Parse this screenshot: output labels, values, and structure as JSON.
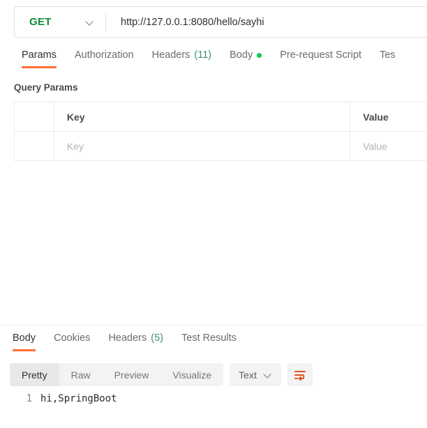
{
  "request": {
    "method": "GET",
    "url": "http://127.0.0.1:8080/hello/sayhi",
    "method_chevron_icon": "chevron-down-icon",
    "tabs": [
      {
        "label": "Params",
        "count": "",
        "active": true,
        "dot": false
      },
      {
        "label": "Authorization",
        "count": "",
        "active": false,
        "dot": false
      },
      {
        "label": "Headers",
        "count": "(11)",
        "active": false,
        "dot": false
      },
      {
        "label": "Body",
        "count": "",
        "active": false,
        "dot": true
      },
      {
        "label": "Pre-request Script",
        "count": "",
        "active": false,
        "dot": false
      },
      {
        "label": "Tes",
        "count": "",
        "active": false,
        "dot": false
      }
    ],
    "params": {
      "section_title": "Query Params",
      "columns": [
        "Key",
        "Value"
      ],
      "rows": [
        {
          "key_placeholder": "Key",
          "value_placeholder": "Value"
        }
      ]
    }
  },
  "response": {
    "tabs": [
      {
        "label": "Body",
        "count": "",
        "active": true
      },
      {
        "label": "Cookies",
        "count": "",
        "active": false
      },
      {
        "label": "Headers",
        "count": "(5)",
        "active": false
      },
      {
        "label": "Test Results",
        "count": "",
        "active": false
      }
    ],
    "view_modes": [
      {
        "label": "Pretty",
        "active": true
      },
      {
        "label": "Raw",
        "active": false
      },
      {
        "label": "Preview",
        "active": false
      },
      {
        "label": "Visualize",
        "active": false
      }
    ],
    "format": {
      "label": "Text",
      "chevron_icon": "chevron-down-icon"
    },
    "wrap_icon": "word-wrap-icon",
    "body": {
      "lines": [
        {
          "number": "1",
          "text": "hi,SpringBoot"
        }
      ]
    }
  },
  "colors": {
    "accent": "#ff6c37",
    "method_get": "#0f8a3c",
    "count": "#3f8f77",
    "dot": "#10cb53"
  }
}
